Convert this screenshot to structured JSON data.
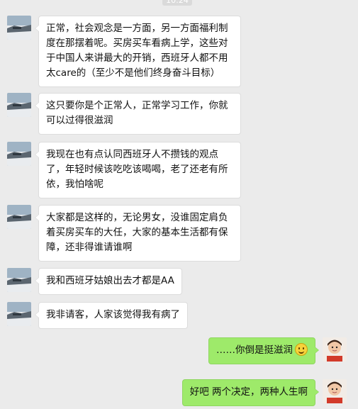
{
  "chat": {
    "timestamp": "10:24",
    "messages": [
      {
        "from": "other",
        "text": "正常，社会观念是一方面，另一方面福利制度在那摆着呢。买房买车看病上学，这些对于中国人来讲最大的开销，西班牙人都不用太care的（至少不是他们终身奋斗目标）"
      },
      {
        "from": "other",
        "text": "这只要你是个正常人，正常学习工作，你就可以过得很滋润"
      },
      {
        "from": "other",
        "text": "我现在也有点认同西班牙人不攒钱的观点了，年轻时候该吃吃该喝喝，老了还老有所依，我怕啥呢"
      },
      {
        "from": "other",
        "text": "大家都是这样的，无论男女，没谁固定肩负着买房买车的大任，大家的基本生活都有保障，还非得谁请谁啊"
      },
      {
        "from": "other",
        "text": "我和西班牙姑娘出去才都是AA"
      },
      {
        "from": "other",
        "text": "我非请客，人家该觉得我有病了"
      },
      {
        "from": "me",
        "text": "……你倒是挺滋润",
        "emoji": "smile-emoji"
      },
      {
        "from": "me",
        "text": "好吧 两个决定，两种人生啊"
      }
    ]
  },
  "colors": {
    "chat_background": "#ebebeb",
    "incoming_bubble": "#ffffff",
    "outgoing_bubble": "#9eea6a"
  }
}
